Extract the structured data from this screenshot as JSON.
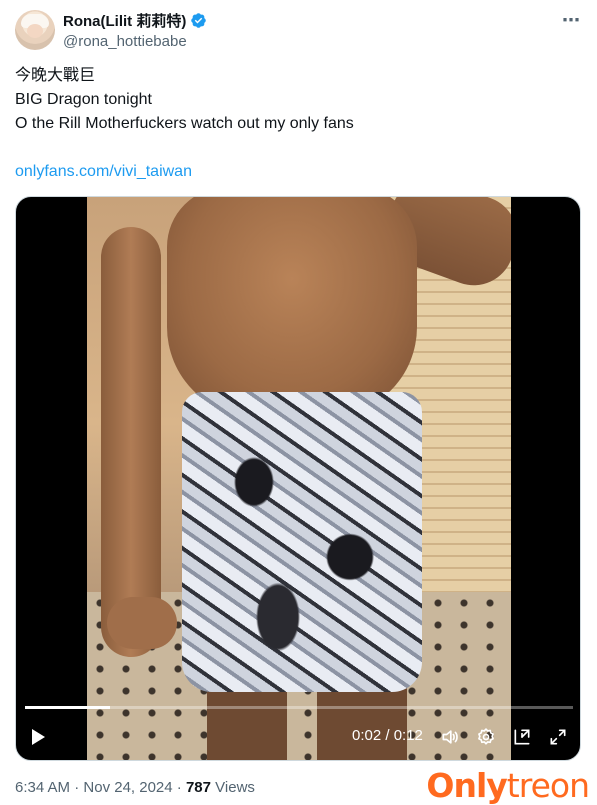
{
  "author": {
    "display_name": "Rona(Lilit 莉莉特)",
    "handle": "@rona_hottiebabe",
    "verified": true,
    "avatar_icon": "avatar-image"
  },
  "more_icon": "⋯",
  "tweet": {
    "lines": [
      "今晚大戰巨",
      "BIG Dragon tonight",
      "O the Rill Motherfuckers watch out my only fans"
    ],
    "link": "onlyfans.com/vivi_taiwan"
  },
  "video": {
    "current_time": "0:02",
    "duration": "0:12",
    "time_display": "0:02 / 0:12",
    "progress": 0.155,
    "icons": [
      "play-icon",
      "volume-icon",
      "settings-icon",
      "pop-out-icon",
      "fullscreen-icon"
    ]
  },
  "footer": {
    "time": "6:34 AM",
    "separator": "·",
    "date": "Nov 24, 2024",
    "views_count": "787",
    "views_label": "Views"
  },
  "watermark": {
    "part1": "Only",
    "part2": "treon"
  },
  "colors": {
    "link": "#1d9bf0",
    "verified": "#1d9bf0",
    "watermark": "#ff6a1f"
  }
}
